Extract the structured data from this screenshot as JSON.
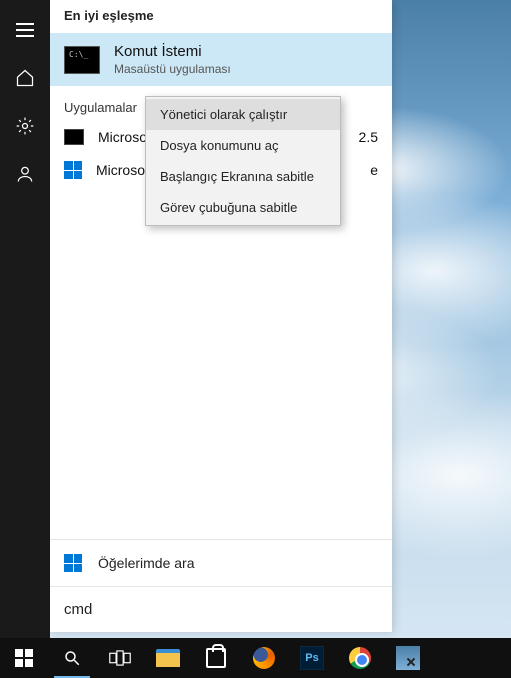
{
  "rail": {
    "hamburger": "menu",
    "home": "home",
    "settings": "settings",
    "user": "user"
  },
  "panel": {
    "header": "En iyi eşleşme",
    "best_match": {
      "title": "Komut İstemi",
      "subtitle": "Masaüstü uygulaması",
      "icon_text": "C:\\_"
    },
    "apps_label": "Uygulamalar",
    "apps": [
      {
        "label": "Microsoft",
        "suffix": "2.5",
        "icon": "cmd"
      },
      {
        "label": "Microsoft",
        "suffix": "e",
        "icon": "win"
      }
    ],
    "my_stuff": "Öğelerimde ara",
    "search_value": "cmd"
  },
  "context_menu": {
    "items": [
      "Yönetici olarak çalıştır",
      "Dosya konumunu aç",
      "Başlangıç Ekranına sabitle",
      "Görev çubuğuna sabitle"
    ]
  },
  "taskbar": {
    "ps_label": "Ps"
  }
}
